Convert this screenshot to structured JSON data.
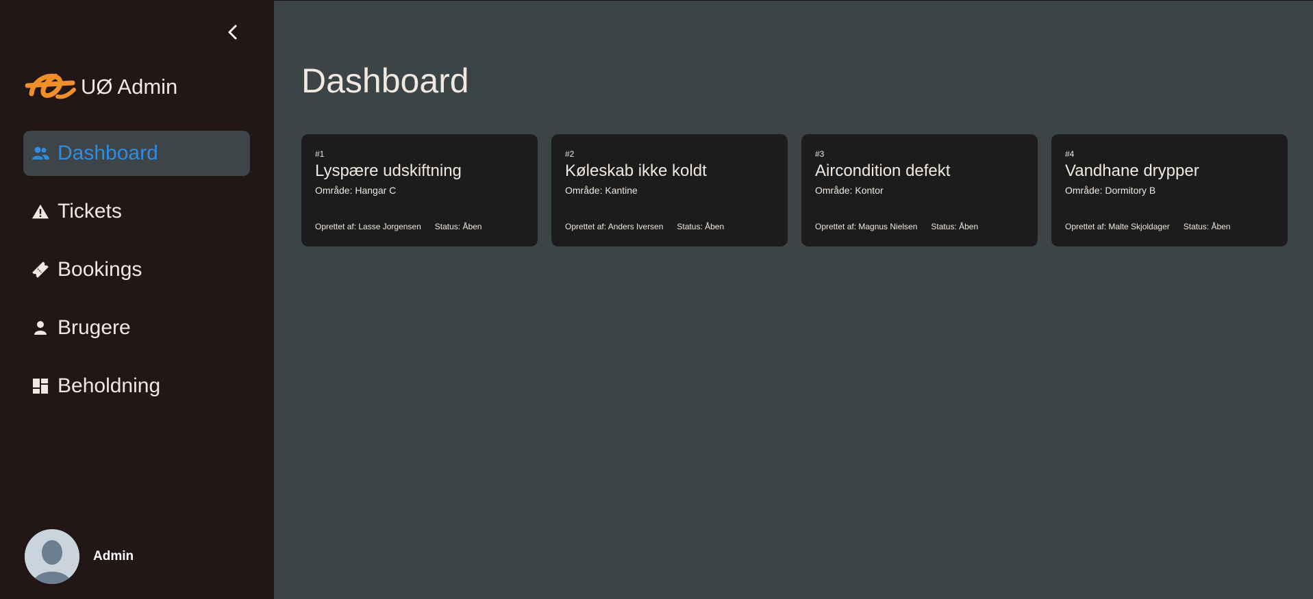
{
  "sidebar": {
    "brand": "UØ Admin",
    "nav": [
      {
        "label": "Dashboard",
        "icon": "users-icon",
        "active": true
      },
      {
        "label": "Tickets",
        "icon": "warning-icon",
        "active": false
      },
      {
        "label": "Bookings",
        "icon": "ticket-icon",
        "active": false
      },
      {
        "label": "Brugere",
        "icon": "person-icon",
        "active": false
      },
      {
        "label": "Beholdning",
        "icon": "dashboard-grid-icon",
        "active": false
      }
    ],
    "user": {
      "name": "Admin"
    }
  },
  "main": {
    "title": "Dashboard",
    "cards": [
      {
        "id": "#1",
        "title": "Lyspære udskiftning",
        "area": "Område: Hangar C",
        "created_by": "Oprettet af: Lasse Jorgensen",
        "status": "Status: Åben"
      },
      {
        "id": "#2",
        "title": "Køleskab ikke koldt",
        "area": "Område: Kantine",
        "created_by": "Oprettet af: Anders Iversen",
        "status": "Status: Åben"
      },
      {
        "id": "#3",
        "title": "Aircondition defekt",
        "area": "Område: Kontor",
        "created_by": "Oprettet af: Magnus Nielsen",
        "status": "Status: Åben"
      },
      {
        "id": "#4",
        "title": "Vandhane drypper",
        "area": "Område: Dormitory B",
        "created_by": "Oprettet af: Malte Skjoldager",
        "status": "Status: Åben"
      }
    ]
  },
  "colors": {
    "sidebar_bg": "#221617",
    "main_bg": "#3d4447",
    "card_bg": "#1c1c1c",
    "accent": "#2e8de0",
    "brand": "#ef8f2a",
    "text": "#f1e9e1"
  }
}
